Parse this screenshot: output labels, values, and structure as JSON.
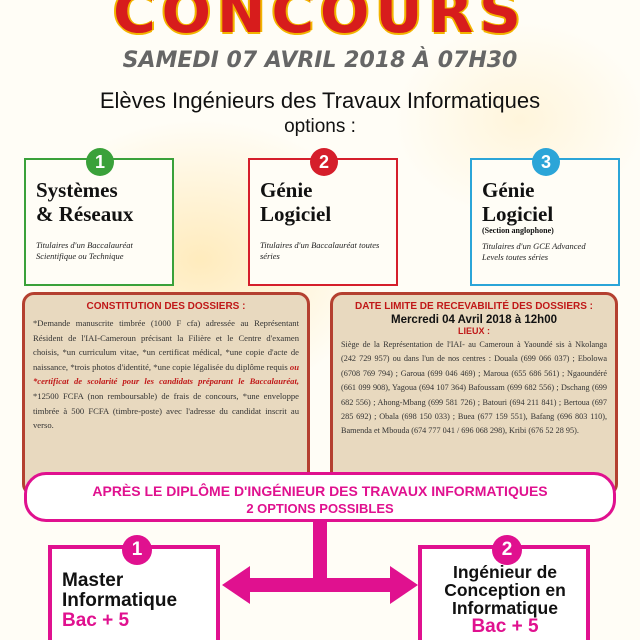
{
  "header": {
    "title": "CONCOURS",
    "date": "SAMEDI 07 AVRIL 2018 À 07H30",
    "heading": "Elèves Ingénieurs des Travaux Informatiques",
    "options_label": "options :"
  },
  "options": [
    {
      "num": "1",
      "title": "Systèmes\n& Réseaux",
      "sub": "",
      "desc": "Titulaires d'un Baccalauréat Scientifique ou Technique"
    },
    {
      "num": "2",
      "title": "Génie\nLogiciel",
      "sub": "",
      "desc": "Titulaires d'un Baccalauréat toutes séries"
    },
    {
      "num": "3",
      "title": "Génie\nLogiciel",
      "sub": "(Section anglophone)",
      "desc": "Titulaires d'un GCE Advanced Levels toutes séries"
    }
  ],
  "dossiers": {
    "title": "CONSTITUTION DES DOSSIERS :",
    "text_a": "*Demande manuscrite timbrée (1000 F cfa) adressée au Représentant Résident de l'IAI-Cameroun précisant la Filière et le Centre d'examen choisis, *un curriculum vitae, *un certificat médical, *une copie d'acte de naissance, *trois photos d'identité, *une copie légalisée du diplôme requis ",
    "text_hl": "ou *certificat de scolarité pour les candidats préparant le Baccalauréat,",
    "text_b": " *12500 FCFA (non remboursable) de frais de concours, *une enveloppe timbrée à 500 FCFA (timbre-poste) avec l'adresse du candidat inscrit au verso."
  },
  "recevabilite": {
    "title": "DATE LIMITE DE RECEVABILITÉ DES DOSSIERS :",
    "date": "Mercredi 04 Avril 2018 à 12h00",
    "lieux_label": "LIEUX :",
    "text": "Siège de la Représentation de l'IAI- au Cameroun à Yaoundé sis à Nkolanga (242 729 957) ou dans l'un de nos centres : Douala (699 066 037) ; Ebolowa (6708 769 794) ; Garoua (699 046 469) ; Maroua (655 686 561) ; Ngaoundéré (661 099 908), Yagoua (694 107 364) Bafoussam (699 682 556) ; Dschang (699 682 556) ; Ahong-Mbang (699 581 726) ; Batouri (694 211 841) ; Bertoua (697 285 692) ; Obala (698 150 033) ; Buea (677 159 551), Bafang (696 803 110), Bamenda et Mbouda (674 777 041 / 696 068 298), Kribi (676 52 28 95)."
  },
  "after": {
    "line1": "APRÈS LE DIPLÔME D'INGÉNIEUR DES TRAVAUX  INFORMATIQUES",
    "line2": "2 OPTIONS POSSIBLES"
  },
  "paths": [
    {
      "num": "1",
      "title": "Master\nInformatique",
      "bac": "Bac + 5"
    },
    {
      "num": "2",
      "title": "Ingénieur de\nConception en\nInformatique",
      "bac": "Bac + 5"
    }
  ],
  "colors": {
    "title_red": "#d71c1c",
    "option1": "#3aa13a",
    "option2": "#d51e2b",
    "option3": "#2ba5d8",
    "pink": "#e0118f",
    "box_fill": "#e8d9bf",
    "box_border": "#b44030"
  }
}
